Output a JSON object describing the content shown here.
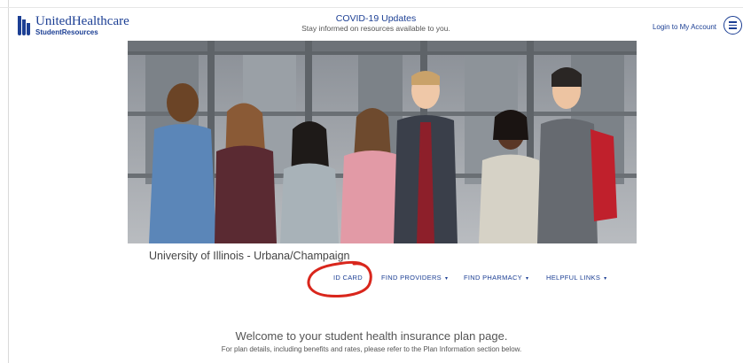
{
  "header": {
    "brand_name": "UnitedHealthcare",
    "brand_sub": "StudentResources",
    "covid_title": "COVID-19 Updates",
    "covid_subtitle": "Stay informed on resources available to you.",
    "login_label": "Login to My Account",
    "menu_icon": "hamburger-menu-icon"
  },
  "hero": {
    "image": "photo of seven smiling students standing in front of a building"
  },
  "university": "University of Illinois - Urbana/Champaign",
  "nav": {
    "items": [
      {
        "label": "ID CARD",
        "has_dropdown": false
      },
      {
        "label": "FIND PROVIDERS",
        "has_dropdown": true
      },
      {
        "label": "FIND PHARMACY",
        "has_dropdown": true
      },
      {
        "label": "HELPFUL LINKS",
        "has_dropdown": true
      }
    ],
    "caret_glyph": "▾"
  },
  "welcome": {
    "title": "Welcome to your student health insurance plan page.",
    "subtitle": "For plan details, including benefits and rates, please refer to the Plan Information section below."
  },
  "colors": {
    "brand_blue": "#1c3f94",
    "annotation_red": "#d9261c"
  }
}
